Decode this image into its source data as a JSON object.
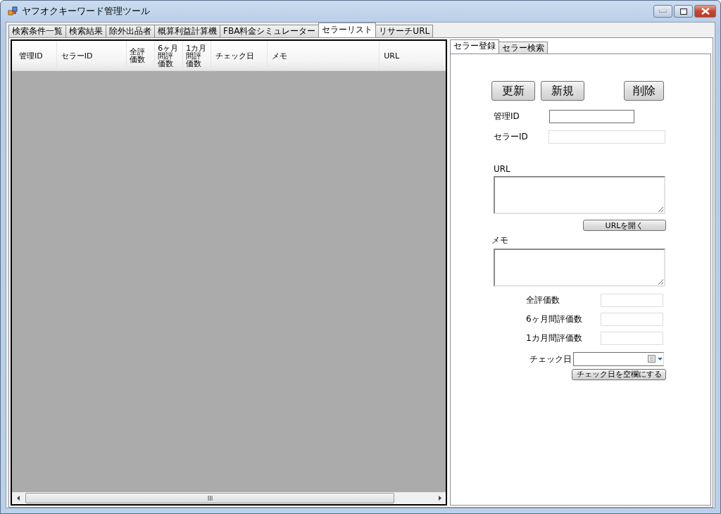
{
  "window": {
    "title": "ヤフオクキーワード管理ツール"
  },
  "tabs": [
    {
      "label": "検索条件一覧",
      "selected": false
    },
    {
      "label": "検索結果",
      "selected": false
    },
    {
      "label": "除外出品者",
      "selected": false
    },
    {
      "label": "概算利益計算機",
      "selected": false
    },
    {
      "label": "FBA料金シミュレーター",
      "selected": false
    },
    {
      "label": "セラーリスト",
      "selected": true
    },
    {
      "label": "リサーチURL",
      "selected": false
    }
  ],
  "table": {
    "columns": [
      "管理ID",
      "セラーID",
      "全評価数",
      "6ヶ月間評価数",
      "1カ月間評価数",
      "チェック日",
      "メモ",
      "URL"
    ]
  },
  "side_tabs": [
    {
      "label": "セラー登録",
      "selected": true
    },
    {
      "label": "セラー検索",
      "selected": false
    }
  ],
  "action_buttons": [
    "更新",
    "新規",
    "削除"
  ],
  "id_fields": [
    {
      "label": "管理ID",
      "focused": true
    },
    {
      "label": "セラーID",
      "focused": false
    }
  ],
  "url": {
    "label": "URL",
    "button": "URLを開く"
  },
  "memo": {
    "label": "メモ"
  },
  "count_fields": [
    {
      "label": "全評価数"
    },
    {
      "label": "6ヶ月間評価数"
    },
    {
      "label": "1カ月間評価数"
    }
  ],
  "check_date": {
    "label": "チェック日",
    "clear_button": "チェック日を空欄にする"
  }
}
